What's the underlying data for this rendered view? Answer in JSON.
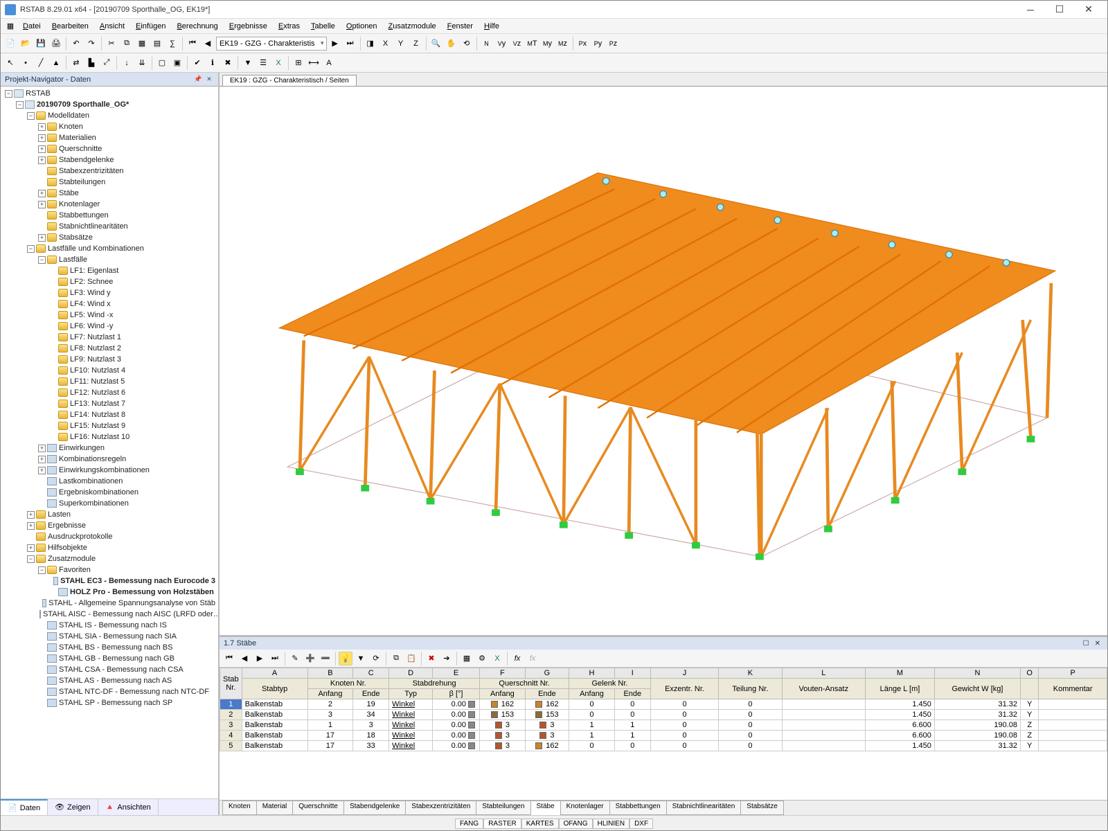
{
  "title": "RSTAB 8.29.01 x64 - [20190709 Sporthalle_OG, EK19*]",
  "menus": [
    "Datei",
    "Bearbeiten",
    "Ansicht",
    "Einfügen",
    "Berechnung",
    "Ergebnisse",
    "Extras",
    "Tabelle",
    "Optionen",
    "Zusatzmodule",
    "Fenster",
    "Hilfe"
  ],
  "combo_ek": "EK19 - GZG - Charakteristis",
  "nav": {
    "title": "Projekt-Navigator - Daten",
    "root": "RSTAB",
    "project": "20190709 Sporthalle_OG*",
    "modelldaten": {
      "label": "Modelldaten",
      "children": [
        "Knoten",
        "Materialien",
        "Querschnitte",
        "Stabendgelenke",
        "Stabexzentrizitäten",
        "Stabteilungen",
        "Stäbe",
        "Knotenlager",
        "Stabbettungen",
        "Stabnichtlinearitäten",
        "Stabsätze"
      ]
    },
    "lastfaelle_root": "Lastfälle und Kombinationen",
    "lastfaelle": {
      "label": "Lastfälle",
      "items": [
        "LF1: Eigenlast",
        "LF2: Schnee",
        "LF3: Wind y",
        "LF4: Wind x",
        "LF5: Wind -x",
        "LF6: Wind -y",
        "LF7: Nutzlast 1",
        "LF8: Nutzlast 2",
        "LF9: Nutzlast 3",
        "LF10: Nutzlast 4",
        "LF11: Nutzlast 5",
        "LF12: Nutzlast 6",
        "LF13: Nutzlast 7",
        "LF14: Nutzlast 8",
        "LF15: Nutzlast 9",
        "LF16: Nutzlast 10"
      ]
    },
    "combos": [
      "Einwirkungen",
      "Kombinationsregeln",
      "Einwirkungskombinationen",
      "Lastkombinationen",
      "Ergebniskombinationen",
      "Superkombinationen"
    ],
    "lasten": "Lasten",
    "ergebnisse": "Ergebnisse",
    "ausdruck": "Ausdruckprotokolle",
    "hilfs": "Hilfsobjekte",
    "zusatz": {
      "label": "Zusatzmodule",
      "fav": "Favoriten",
      "fav_items": [
        "STAHL EC3 - Bemessung nach Eurocode 3",
        "HOLZ Pro - Bemessung von Holzstäben"
      ],
      "modules": [
        "STAHL - Allgemeine Spannungsanalyse von Stäb",
        "STAHL AISC - Bemessung nach AISC (LRFD oder…",
        "STAHL IS - Bemessung nach IS",
        "STAHL SIA - Bemessung nach SIA",
        "STAHL BS - Bemessung nach BS",
        "STAHL GB - Bemessung nach GB",
        "STAHL CSA - Bemessung nach CSA",
        "STAHL AS - Bemessung nach AS",
        "STAHL NTC-DF - Bemessung nach NTC-DF",
        "STAHL SP - Bemessung nach SP"
      ]
    },
    "tabs": [
      "Daten",
      "Zeigen",
      "Ansichten"
    ]
  },
  "view_tab": "EK19 : GZG - Charakteristisch / Seiten",
  "table": {
    "title": "1.7 Stäbe",
    "col_letters": [
      "A",
      "B",
      "C",
      "D",
      "E",
      "F",
      "G",
      "H",
      "I",
      "J",
      "K",
      "L",
      "M",
      "N",
      "O",
      "P"
    ],
    "group_headers": {
      "stab_nr": "Stab Nr.",
      "stabtyp": "Stabtyp",
      "knoten": "Knoten Nr.",
      "drehung": "Stabdrehung",
      "quer": "Querschnitt Nr.",
      "gelenk": "Gelenk Nr.",
      "exz": "Exzentr. Nr.",
      "teil": "Teilung Nr.",
      "vouten": "Vouten-Ansatz",
      "laenge": "Länge L [m]",
      "gewicht": "Gewicht W [kg]",
      "kommentar": "Kommentar"
    },
    "sub_headers": {
      "anfang": "Anfang",
      "ende": "Ende",
      "typ": "Typ",
      "beta": "β [°]"
    },
    "rows": [
      {
        "n": 1,
        "styp": "Balkenstab",
        "ka": 2,
        "ke": 19,
        "dtyp": "Winkel",
        "beta": "0.00",
        "qa": 162,
        "qe": 162,
        "ga": 0,
        "ge": 0,
        "ex": 0,
        "te": 0,
        "vo": "",
        "l": "1.450",
        "w": "31.32",
        "ax": "Y"
      },
      {
        "n": 2,
        "styp": "Balkenstab",
        "ka": 3,
        "ke": 34,
        "dtyp": "Winkel",
        "beta": "0.00",
        "qa": 153,
        "qe": 153,
        "ga": 0,
        "ge": 0,
        "ex": 0,
        "te": 0,
        "vo": "",
        "l": "1.450",
        "w": "31.32",
        "ax": "Y"
      },
      {
        "n": 3,
        "styp": "Balkenstab",
        "ka": 1,
        "ke": 3,
        "dtyp": "Winkel",
        "beta": "0.00",
        "qa": 3,
        "qe": 3,
        "ga": 1,
        "ge": 1,
        "ex": 0,
        "te": 0,
        "vo": "",
        "l": "6.600",
        "w": "190.08",
        "ax": "Z"
      },
      {
        "n": 4,
        "styp": "Balkenstab",
        "ka": 17,
        "ke": 18,
        "dtyp": "Winkel",
        "beta": "0.00",
        "qa": 3,
        "qe": 3,
        "ga": 1,
        "ge": 1,
        "ex": 0,
        "te": 0,
        "vo": "",
        "l": "6.600",
        "w": "190.08",
        "ax": "Z"
      },
      {
        "n": 5,
        "styp": "Balkenstab",
        "ka": 17,
        "ke": 33,
        "dtyp": "Winkel",
        "beta": "0.00",
        "qa": 3,
        "qe": 162,
        "ga": 0,
        "ge": 0,
        "ex": 0,
        "te": 0,
        "vo": "",
        "l": "1.450",
        "w": "31.32",
        "ax": "Y"
      }
    ],
    "tabs": [
      "Knoten",
      "Material",
      "Querschnitte",
      "Stabendgelenke",
      "Stabexzentrizitäten",
      "Stabteilungen",
      "Stäbe",
      "Knotenlager",
      "Stabbettungen",
      "Stabnichtlinearitäten",
      "Stabsätze"
    ],
    "active_tab": 6
  },
  "status": [
    "FANG",
    "RASTER",
    "KARTES",
    "OFANG",
    "HLINIEN",
    "DXF"
  ]
}
